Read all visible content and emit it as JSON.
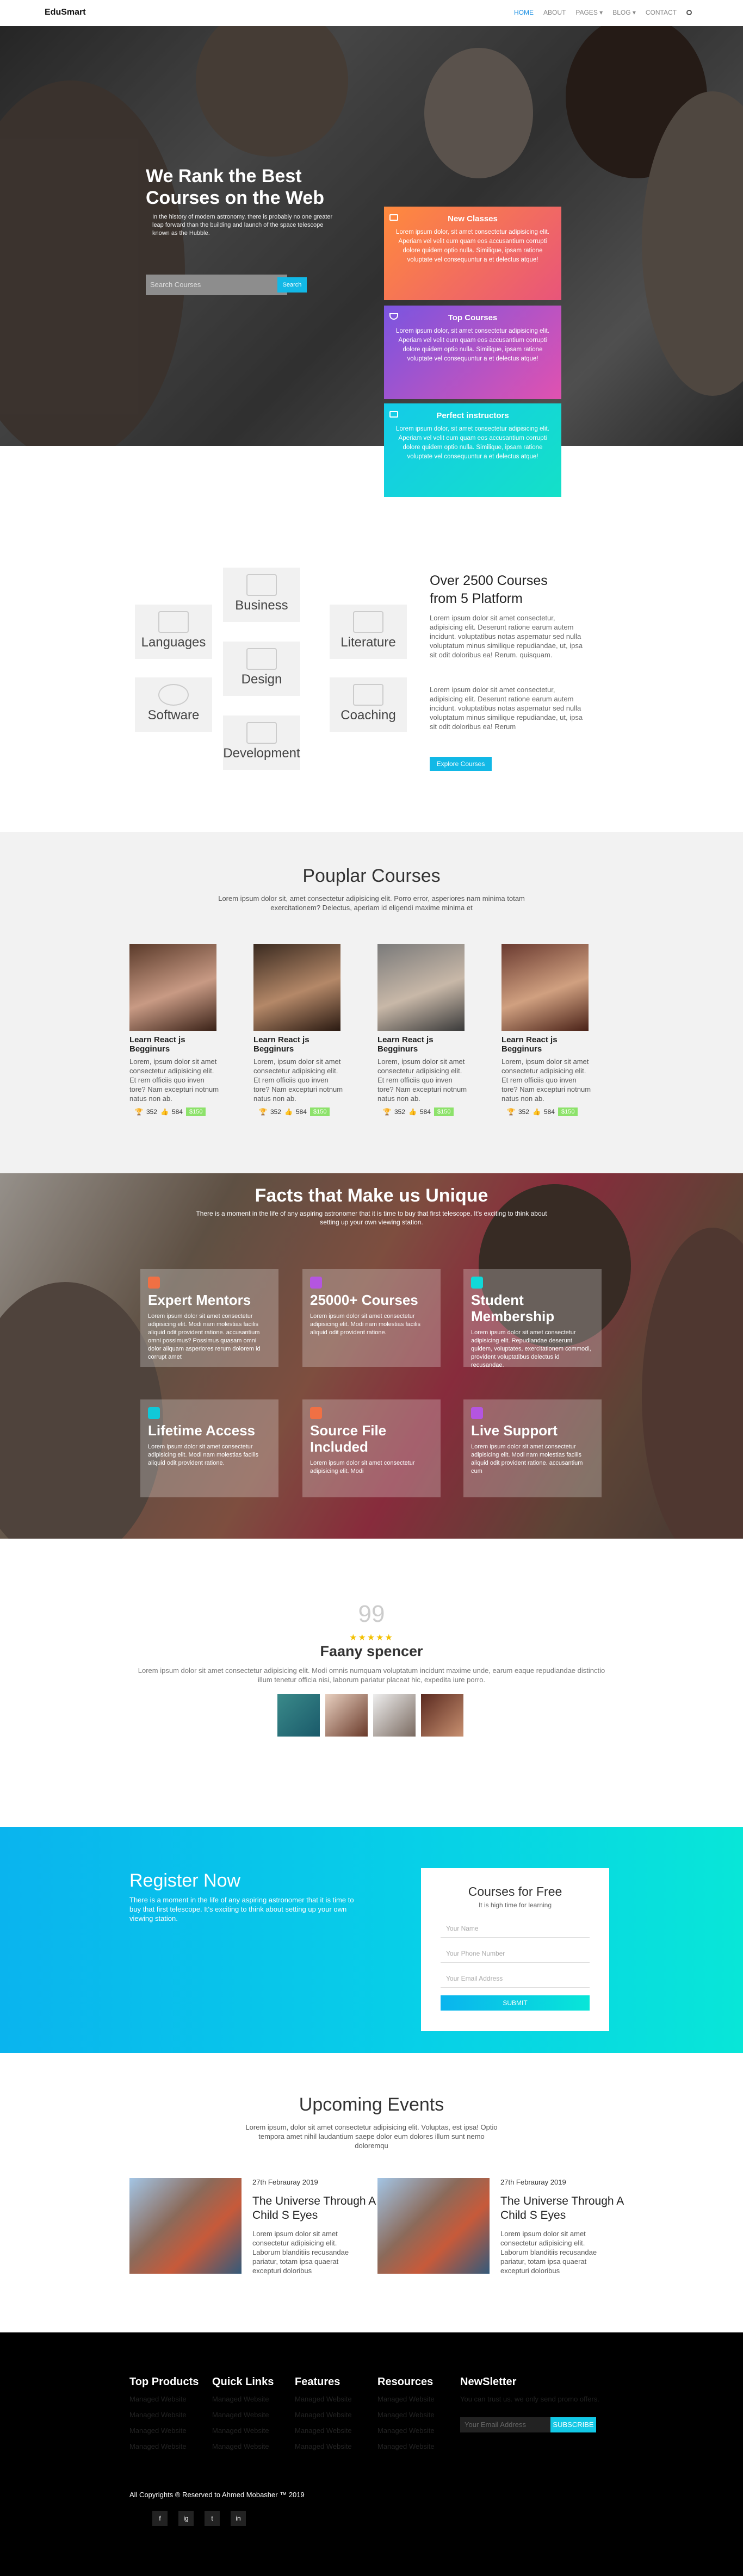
{
  "nav": {
    "brand": "EduSmart",
    "items": [
      "HOME",
      "ABOUT",
      "PAGES ▾",
      "BLOG ▾",
      "CONTACT"
    ],
    "search_icon": "search-icon"
  },
  "hero": {
    "title": "We Rank the Best Courses on the Web",
    "text": "In the history of modern astronomy, there is probably no one greater leap forward than the building and launch of the space telescope known as the Hubble.",
    "search_placeholder": "Search Courses",
    "search_button": "Search",
    "cards": [
      {
        "title": "New Classes",
        "icon": "ticket-icon",
        "text": "Lorem ipsum dolor, sit amet consectetur adipisicing elit. Aperiam vel velit eum quam eos accusantium corrupti dolore quidem optio nulla. Similique, ipsam ratione voluptate vel consequuntur a et delectus atque!",
        "color": "#f07044"
      },
      {
        "title": "Top Courses",
        "icon": "trophy-icon",
        "text": "Lorem ipsum dolor, sit amet consectetur adipisicing elit. Aperiam vel velit eum quam eos accusantium corrupti dolore quidem optio nulla. Similique, ipsam ratione voluptate vel consequuntur a et delectus atque!",
        "color": "#b455e0"
      },
      {
        "title": "Perfect instructors",
        "icon": "monitor-icon",
        "text": "Lorem ipsum dolor, sit amet consectetur adipisicing elit. Aperiam vel velit eum quam eos accusantium corrupti dolore quidem optio nulla. Similique, ipsam ratione voluptate vel consequuntur a et delectus atque!",
        "color": "#10d8d8"
      }
    ]
  },
  "platform": {
    "categories": [
      "Business",
      "Languages",
      "Literature",
      "Design",
      "Software",
      "Coaching",
      "Development"
    ],
    "title": "Over 2500 Courses from 5 Platform",
    "p1": "Lorem ipsum dolor sit amet consectetur, adipisicing elit. Deserunt ratione earum autem incidunt. voluptatibus notas aspernatur sed nulla voluptatum minus similique repudiandae, ut, ipsa sit odit doloribus ea! Rerum. quisquam.",
    "p2": "Lorem ipsum dolor sit amet consectetur, adipisicing elit. Deserunt ratione earum autem incidunt. voluptatibus notas aspernatur sed nulla voluptatum minus similique repudiandae, ut, ipsa sit odit doloribus ea! Rerum",
    "button": "Explore Courses"
  },
  "popular": {
    "title": "Pouplar Courses",
    "subtitle": "Lorem ipsum dolor sit, amet consectetur adipisicing elit. Porro error, asperiores nam minima totam exercitationem? Delectus, aperiam id eligendi maxime minima et",
    "courses": [
      {
        "name": "Learn React js Begginurs",
        "desc": "Lorem, ipsum dolor sit amet consectetur adipisicing elit. Et rem officiis quo inven tore? Nam excepturi notnum natus non ab.",
        "trophies": "352",
        "likes": "584",
        "price": "$150"
      },
      {
        "name": "Learn React js Begginurs",
        "desc": "Lorem, ipsum dolor sit amet consectetur adipisicing elit. Et rem officiis quo inven tore? Nam excepturi notnum natus non ab.",
        "trophies": "352",
        "likes": "584",
        "price": "$150"
      },
      {
        "name": "Learn React js Begginurs",
        "desc": "Lorem, ipsum dolor sit amet consectetur adipisicing elit. Et rem officiis quo inven tore? Nam excepturi notnum natus non ab.",
        "trophies": "352",
        "likes": "584",
        "price": "$150"
      },
      {
        "name": "Learn React js Begginurs",
        "desc": "Lorem, ipsum dolor sit amet consectetur adipisicing elit. Et rem officiis quo inven tore? Nam excepturi notnum natus non ab.",
        "trophies": "352",
        "likes": "584",
        "price": "$150"
      }
    ]
  },
  "facts": {
    "title": "Facts that Make us Unique",
    "subtitle": "There is a moment in the life of any aspiring astronomer that it is time to buy that first telescope. It's exciting to think about setting up your own viewing station.",
    "cards": [
      {
        "title": "Expert Mentors",
        "text": "Lorem ipsum dolor sit amet consectetur adipisicing elit. Modi nam molestias facilis aliquid odit provident ratione. accusantium omni possimus? Possimus quasam omni dolor aliquam asperiores rerum dolorem id corrupt amet",
        "color": "#f07044"
      },
      {
        "title": "25000+ Courses",
        "text": "Lorem ipsum dolor sit amet consectetur adipisicing elit. Modi nam molestias facilis aliquid odit provident ratione.",
        "color": "#b455e0"
      },
      {
        "title": "Student Membership",
        "text": "Lorem ipsum dolor sit amet consectetur adipisicing elit. Repudiandae deserunt quidem, voluptates, exercitationem commodi, provident voluptatibus delectus id recusandae.",
        "color": "#10d8d8"
      },
      {
        "title": "Lifetime Access",
        "text": "Lorem ipsum dolor sit amet consectetur adipisicing elit. Modi nam molestias facilis aliquid odit provident ratione.",
        "color": "#10c8d8"
      },
      {
        "title": "Source File Included",
        "text": "Lorem ipsum dolor sit amet consectetur adipisicing elit. Modi",
        "color": "#f07044"
      },
      {
        "title": "Live Support",
        "text": "Lorem ipsum dolor sit amet consectetur adipisicing elit. Modi nam molestias facilis aliquid odit provident ratione. accusantium cum",
        "color": "#b455e0"
      }
    ]
  },
  "testimonial": {
    "quote_mark": "99",
    "stars": "★★★★★",
    "name": "Faany spencer",
    "text": "Lorem ipsum dolor sit amet consectetur adipisicing elit. Modi omnis numquam voluptatum incidunt maxime unde, earum eaque repudiandae distinctio illum tenetur officia nisi, laborum pariatur placeat hic, expedita iure porro."
  },
  "register": {
    "title": "Register Now",
    "text": "There is a moment in the life of any aspiring astronomer that it is time to buy that first telescope. It's exciting to think about setting up your own viewing station.",
    "form_title": "Courses for Free",
    "form_sub": "It is high time for learning",
    "name_placeholder": "Your Name",
    "phone_placeholder": "Your Phone Number",
    "email_placeholder": "Your Email Address",
    "submit": "SUBMIT"
  },
  "events": {
    "title": "Upcoming Events",
    "subtitle": "Lorem ipsum, dolor sit amet consectetur adipisicing elit. Voluptas, est ipsa! Optio tempora amet nihil laudantium saepe dolor eum dolores illum sunt nemo doloremqu",
    "items": [
      {
        "date": "27th Febrauray 2019",
        "title": "The Universe Through A Child S Eyes",
        "text": "Lorem ipsum dolor sit amet consectetur adipisicing elit. Laborum blanditiis recusandae pariatur, totam ipsa quaerat excepturi doloribus"
      },
      {
        "date": "27th Febrauray 2019",
        "title": "The Universe Through A Child S Eyes",
        "text": "Lorem ipsum dolor sit amet consectetur adipisicing elit. Laborum blanditiis recusandae pariatur, totam ipsa quaerat excepturi doloribus"
      }
    ]
  },
  "footer": {
    "cols": [
      {
        "heading": "Top Products",
        "links": [
          "Managed Website",
          "Managed Website",
          "Managed Website",
          "Managed Website"
        ]
      },
      {
        "heading": "Quick Links",
        "links": [
          "Managed Website",
          "Managed Website",
          "Managed Website",
          "Managed Website"
        ]
      },
      {
        "heading": "Features",
        "links": [
          "Managed Website",
          "Managed Website",
          "Managed Website",
          "Managed Website"
        ]
      },
      {
        "heading": "Resources",
        "links": [
          "Managed Website",
          "Managed Website",
          "Managed Website",
          "Managed Website"
        ]
      }
    ],
    "newsletter_heading": "NewSletter",
    "newsletter_text": "You can trust us. we only send promo offers.",
    "email_placeholder": "Your Email Address",
    "subscribe": "SUBSCRIBE",
    "copyright": "All Copyrights ® Reserved to Ahmed Mobasher ™ 2019",
    "social": [
      "f",
      "ig",
      "t",
      "in"
    ]
  }
}
